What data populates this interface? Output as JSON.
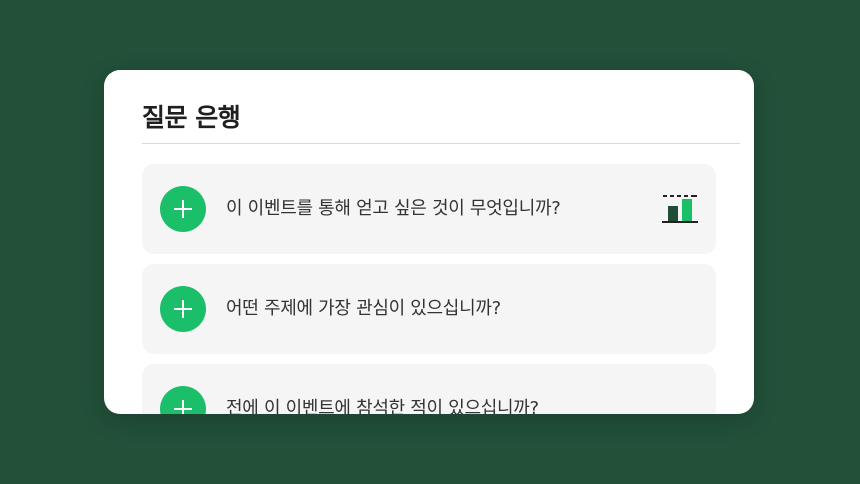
{
  "panel": {
    "title": "질문 은행"
  },
  "questions": [
    {
      "text": "이 이벤트를 통해 얻고 싶은 것이 무엇입니까?",
      "icon": "poll-chart-icon"
    },
    {
      "text": "어떤 주제에 가장 관심이 있으십니까?"
    },
    {
      "text": "전에 이 이벤트에 참석한 적이 있으십니까?"
    }
  ],
  "colors": {
    "background": "#225039",
    "accent": "#1cbf69",
    "card": "#ffffff",
    "item": "#f5f5f5"
  }
}
